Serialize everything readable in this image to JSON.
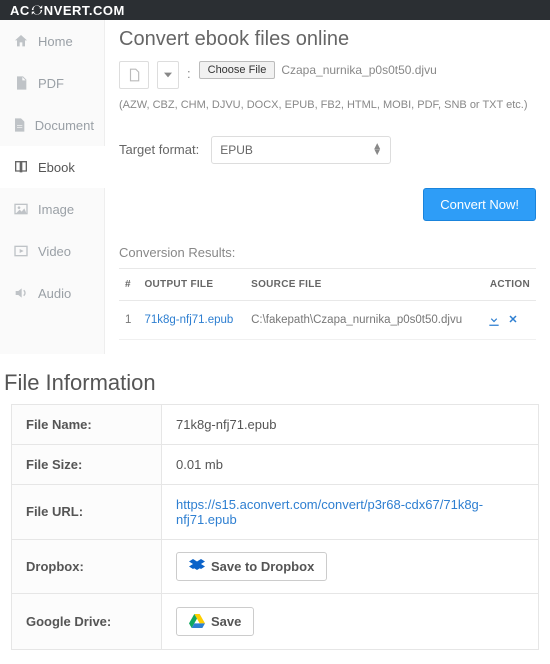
{
  "brand": {
    "pre": "AC",
    "post": "NVERT.COM"
  },
  "sidebar": {
    "items": [
      {
        "label": "Home"
      },
      {
        "label": "PDF"
      },
      {
        "label": "Document"
      },
      {
        "label": "Ebook"
      },
      {
        "label": "Image"
      },
      {
        "label": "Video"
      },
      {
        "label": "Audio"
      }
    ]
  },
  "main": {
    "heading": "Convert ebook files online",
    "choose_file_btn": "Choose File",
    "selected_filename": "Czapa_nurnika_p0s0t50.djvu",
    "hint": "(AZW, CBZ, CHM, DJVU, DOCX, EPUB, FB2, HTML, MOBI, PDF, SNB or TXT etc.)",
    "target_label": "Target format:",
    "target_value": "EPUB",
    "convert_btn": "Convert Now!",
    "results_title": "Conversion Results:",
    "results": {
      "cols": {
        "num": "#",
        "out": "OUTPUT FILE",
        "src": "SOURCE FILE",
        "act": "ACTION"
      },
      "rows": [
        {
          "num": "1",
          "out": "71k8g-nfj71.epub",
          "src": "C:\\fakepath\\Czapa_nurnika_p0s0t50.djvu"
        }
      ]
    }
  },
  "fileinfo": {
    "heading": "File Information",
    "rows": {
      "name_key": "File Name:",
      "name_val": "71k8g-nfj71.epub",
      "size_key": "File Size:",
      "size_val": "0.01 mb",
      "url_key": "File URL:",
      "url_val": "https://s15.aconvert.com/convert/p3r68-cdx67/71k8g-nfj71.epub",
      "dropbox_key": "Dropbox:",
      "dropbox_btn": "Save to Dropbox",
      "gdrive_key": "Google Drive:",
      "gdrive_btn": "Save"
    }
  }
}
